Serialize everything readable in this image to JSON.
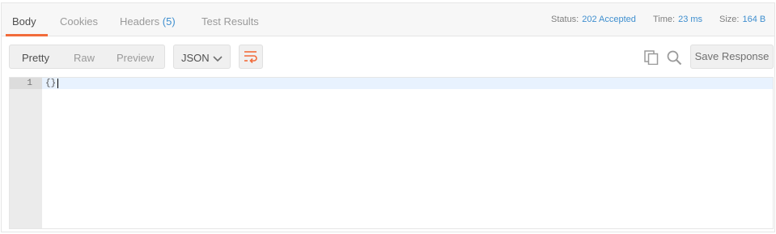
{
  "tabs": {
    "body": "Body",
    "cookies": "Cookies",
    "headers": "Headers",
    "headers_count": "(5)",
    "test_results": "Test Results"
  },
  "status": {
    "status_label": "Status:",
    "status_value": "202 Accepted",
    "time_label": "Time:",
    "time_value": "23 ms",
    "size_label": "Size:",
    "size_value": "164 B"
  },
  "toolbar": {
    "view_modes": [
      "Pretty",
      "Raw",
      "Preview"
    ],
    "active_view": "Pretty",
    "format": "JSON",
    "save_label": "Save Response"
  },
  "editor": {
    "line_number": "1",
    "content": "{}"
  },
  "colors": {
    "accent": "#f26b3a",
    "link": "#3f8fcf"
  },
  "icons": [
    "chevron-down-icon",
    "wrap-lines-icon",
    "copy-icon",
    "search-icon"
  ]
}
